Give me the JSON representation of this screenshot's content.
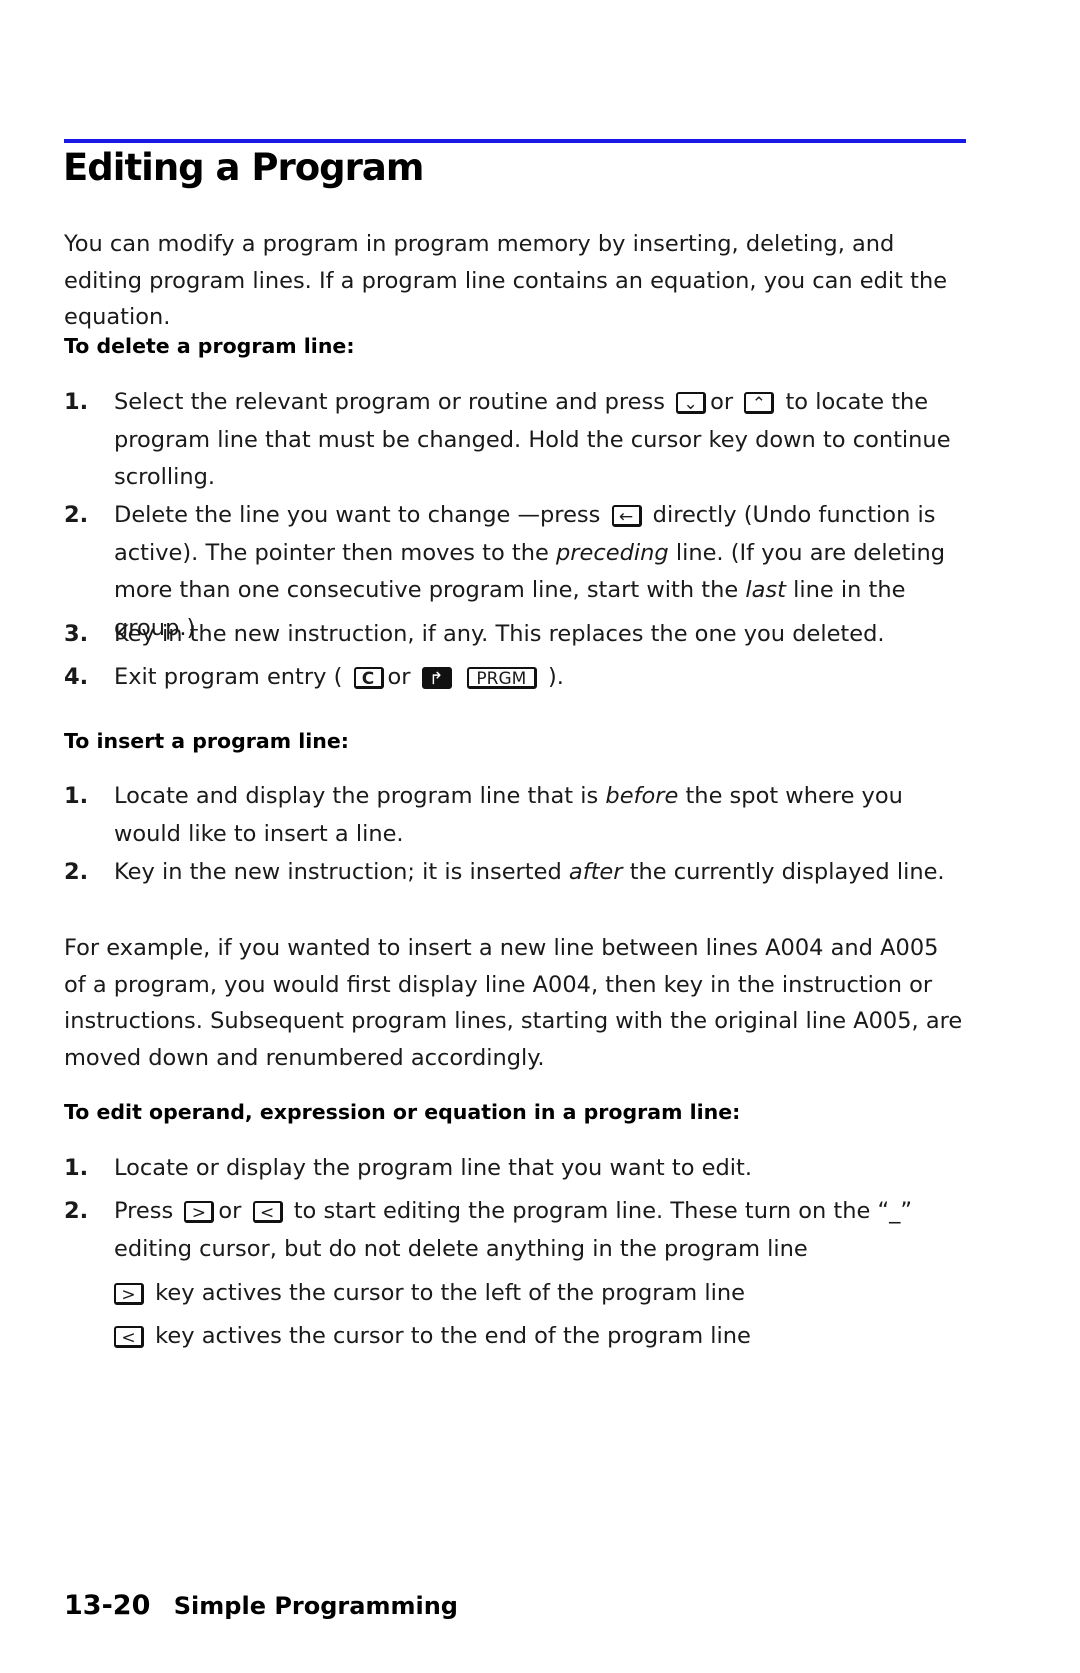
{
  "title": "Editing a Program",
  "intro": "You can modify a program in program memory by inserting, deleting, and editing program lines. If a program line contains an equation, you can edit the equation.",
  "delete": {
    "heading": "To delete a program line:",
    "s1": {
      "n": "1.",
      "a": "Select the relevant program or routine and press",
      "k1": "⌄",
      "or": "or",
      "k2": "⌃",
      "b": "to locate the program line that must be changed. Hold the cursor key down to continue scrolling."
    },
    "s2": {
      "n": "2.",
      "a": "Delete the line you want to change —press",
      "k": "←",
      "b": "directly (Undo function is active). The pointer then moves to the",
      "em1": "preceding",
      "c": "line. (If you are deleting more than one consecutive program line, start with the",
      "em2": "last",
      "d": "line in the group.)"
    },
    "s3": {
      "n": "3.",
      "a": "Key in the new instruction, if any. This replaces the one you deleted."
    },
    "s4": {
      "n": "4.",
      "a": "Exit program entry (",
      "k1": "C",
      "or": "or",
      "k2": "↱",
      "k3": "PRGM",
      "b": ")."
    }
  },
  "insert": {
    "heading": "To insert a program line:",
    "s1": {
      "n": "1.",
      "a": "Locate and display the program line that is",
      "em": "before",
      "b": "the spot where you would like to insert a line."
    },
    "s2": {
      "n": "2.",
      "a": "Key in the new instruction; it is inserted",
      "em": "after",
      "b": "the currently displayed line."
    }
  },
  "example": "For example, if you wanted to insert a new line between lines A004 and A005 of a program, you would first display line A004, then key in the instruction or instructions. Subsequent program lines, starting with the original line A005, are moved down and renumbered accordingly.",
  "edit": {
    "heading": "To edit operand, expression or equation in a program line:",
    "s1": {
      "n": "1.",
      "a": "Locate or display the program line that you want to edit."
    },
    "s2": {
      "n": "2.",
      "a": "Press",
      "k1": ">",
      "or": "or",
      "k2": "<",
      "b": "to start editing the program line. These turn on the “_” editing cursor, but do not delete anything in the program line"
    },
    "sub1": {
      "k": ">",
      "t": "key actives the cursor to the left of the program line"
    },
    "sub2": {
      "k": "<",
      "t": "key actives the cursor to the end of the program line"
    }
  },
  "footer": {
    "page": "13-20",
    "section": "Simple Programming"
  }
}
